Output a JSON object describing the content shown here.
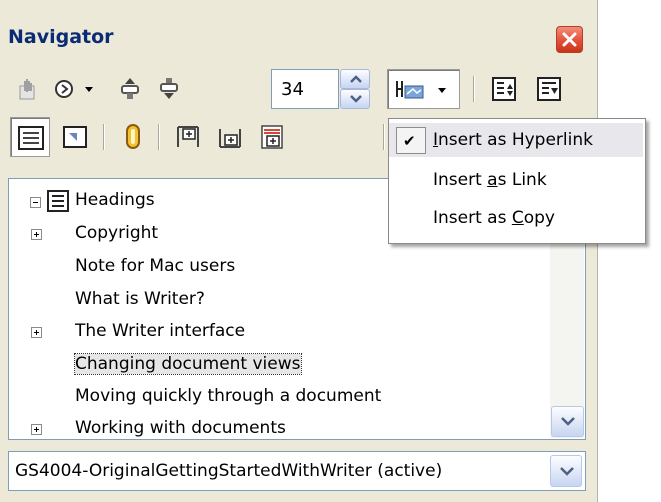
{
  "navigator": {
    "title": "Navigator",
    "spin_value": "34",
    "tree": {
      "root": "Headings",
      "items": [
        {
          "label": "Copyright",
          "expandable": true
        },
        {
          "label": "Note for Mac users",
          "expandable": false
        },
        {
          "label": "What is Writer?",
          "expandable": false
        },
        {
          "label": "The Writer interface",
          "expandable": true
        },
        {
          "label": "Changing document views",
          "expandable": false,
          "selected": true
        },
        {
          "label": "Moving quickly through a document",
          "expandable": false
        },
        {
          "label": "Working with documents",
          "expandable": true
        }
      ]
    },
    "document_select": "GS4004-OriginalGettingStartedWithWriter (active)"
  },
  "drag_mode_menu": {
    "items": [
      {
        "pre": "",
        "key": "I",
        "post": "nsert as Hyperlink",
        "checked": true
      },
      {
        "pre": "Insert ",
        "key": "a",
        "post": "s Link",
        "checked": false
      },
      {
        "pre": "Insert as ",
        "key": "C",
        "post": "opy",
        "checked": false
      }
    ],
    "check_mark": "✔"
  },
  "icons": [
    "toggle-icon",
    "navigation-icon",
    "previous-icon",
    "next-icon",
    "drag-mode-icon",
    "promote-level-icon",
    "demote-level-icon",
    "list-box-icon",
    "content-view-icon",
    "set-reminder-icon",
    "header-icon",
    "footer-icon",
    "anchor-icon",
    "close-icon"
  ],
  "colors": {
    "title": "#0b2b74",
    "panel": "#ece9d8",
    "close": "#e2513a"
  }
}
